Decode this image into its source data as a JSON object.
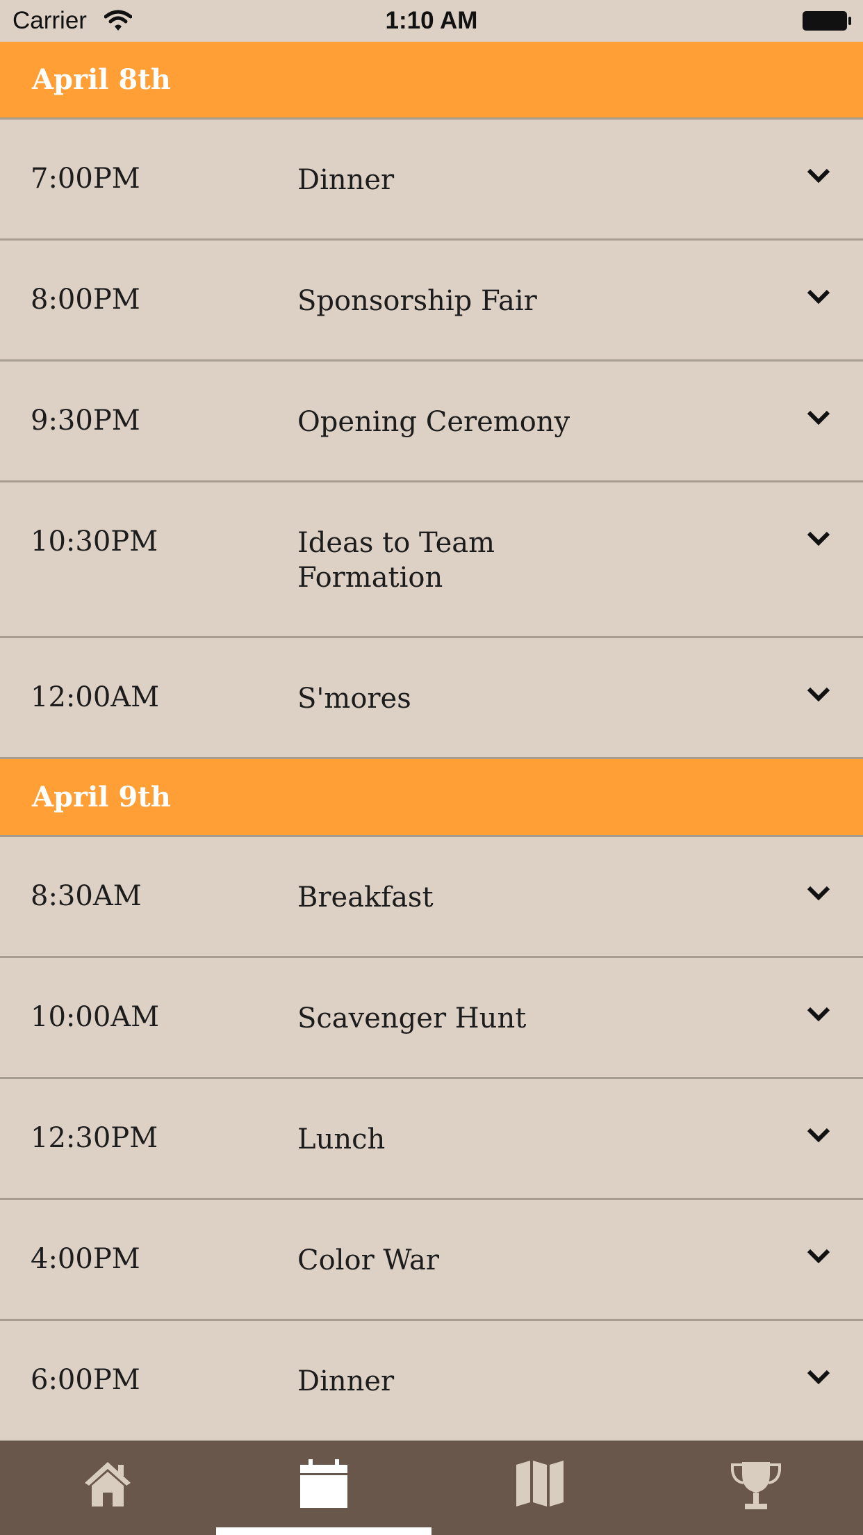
{
  "status_bar": {
    "carrier": "Carrier",
    "time": "1:10 AM"
  },
  "schedule": {
    "days": [
      {
        "label": "April 8th",
        "events": [
          {
            "time": "7:00PM",
            "title": "Dinner"
          },
          {
            "time": "8:00PM",
            "title": "Sponsorship Fair"
          },
          {
            "time": "9:30PM",
            "title": "Opening Ceremony"
          },
          {
            "time": "10:30PM",
            "title": "Ideas to Team Formation"
          },
          {
            "time": "12:00AM",
            "title": "S'mores"
          }
        ]
      },
      {
        "label": "April 9th",
        "events": [
          {
            "time": "8:30AM",
            "title": "Breakfast"
          },
          {
            "time": "10:00AM",
            "title": "Scavenger Hunt"
          },
          {
            "time": "12:30PM",
            "title": "Lunch"
          },
          {
            "time": "4:00PM",
            "title": "Color War"
          },
          {
            "time": "6:00PM",
            "title": "Dinner"
          }
        ]
      }
    ]
  },
  "tab_bar": {
    "tabs": [
      {
        "icon": "home-icon",
        "selected": false
      },
      {
        "icon": "calendar-icon",
        "selected": true
      },
      {
        "icon": "map-icon",
        "selected": false
      },
      {
        "icon": "trophy-icon",
        "selected": false
      }
    ]
  },
  "colors": {
    "background": "#ddd0c4",
    "header": "#ff9f36",
    "tab_bar": "#69574c",
    "tab_icon": "#d9cdbf",
    "selected_tab_icon": "#ffffff"
  }
}
